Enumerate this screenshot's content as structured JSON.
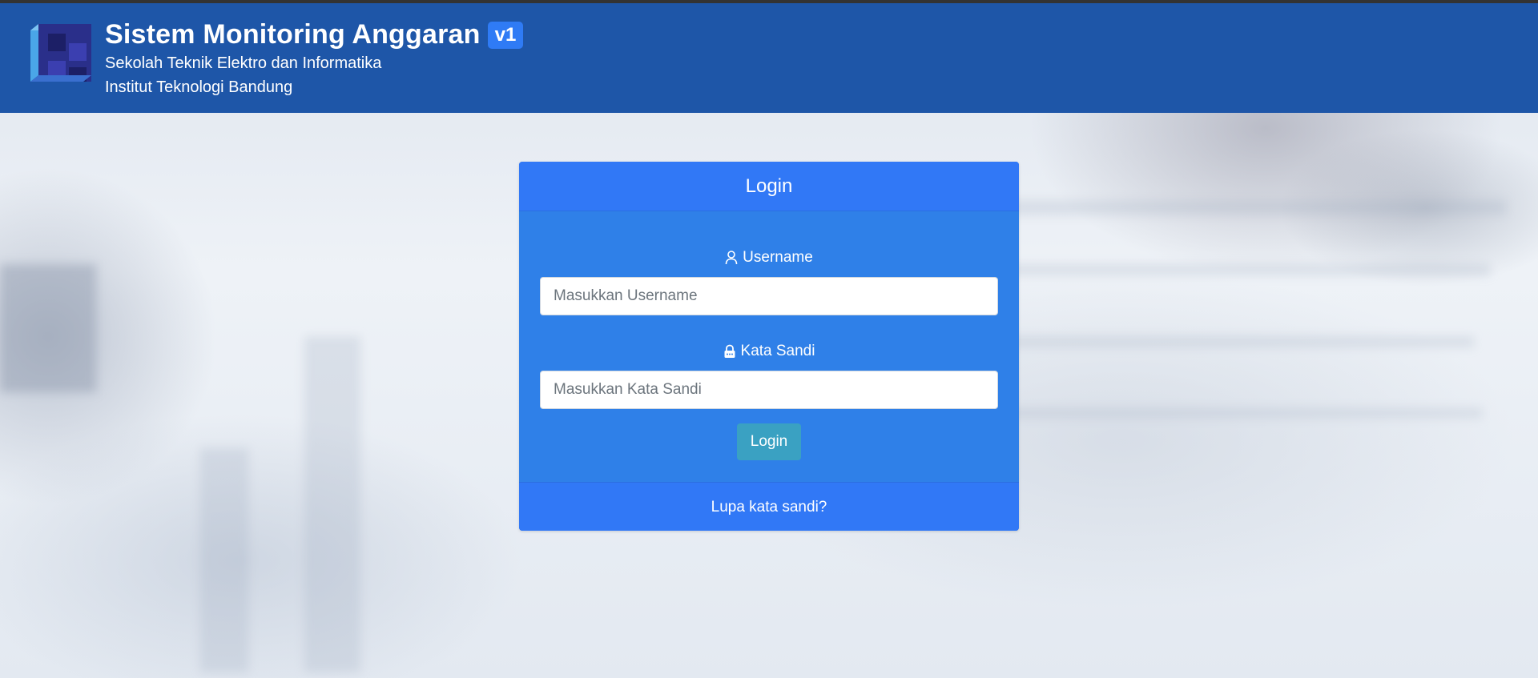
{
  "header": {
    "title": "Sistem Monitoring Anggaran",
    "version_badge": "v1",
    "subtitle_line1": "Sekolah Teknik Elektro dan Informatika",
    "subtitle_line2": "Institut Teknologi Bandung",
    "background_color": "#1e56a8"
  },
  "login_card": {
    "title": "Login",
    "username": {
      "label": "Username",
      "icon": "user-icon",
      "placeholder": "Masukkan Username",
      "value": ""
    },
    "password": {
      "label": "Kata Sandi",
      "icon": "lock-icon",
      "placeholder": "Masukkan Kata Sandi",
      "value": ""
    },
    "submit_label": "Login",
    "forgot_password_label": "Lupa kata sandi?",
    "colors": {
      "header": "#3178f6",
      "body": "#2f80e8",
      "button": "#3aa1c2"
    }
  }
}
